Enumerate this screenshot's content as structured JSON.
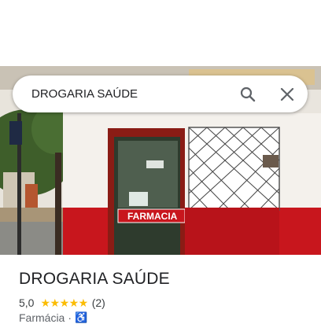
{
  "search": {
    "query": "DROGARIA SAÚDE"
  },
  "place": {
    "name": "DROGARIA SAÚDE",
    "rating": "5,0",
    "stars": "★★★★★",
    "review_count": "(2)",
    "category": "Farmácia",
    "separator": "·",
    "accessibility_icon": "♿"
  },
  "photo": {
    "sign_text": "FARMACIA"
  },
  "icons": {
    "search": "search-icon",
    "close": "close-icon",
    "accessibility": "wheelchair-icon"
  },
  "colors": {
    "star": "#fbbc04",
    "wall_red": "#c8161d",
    "accent": "#1a73e8"
  }
}
